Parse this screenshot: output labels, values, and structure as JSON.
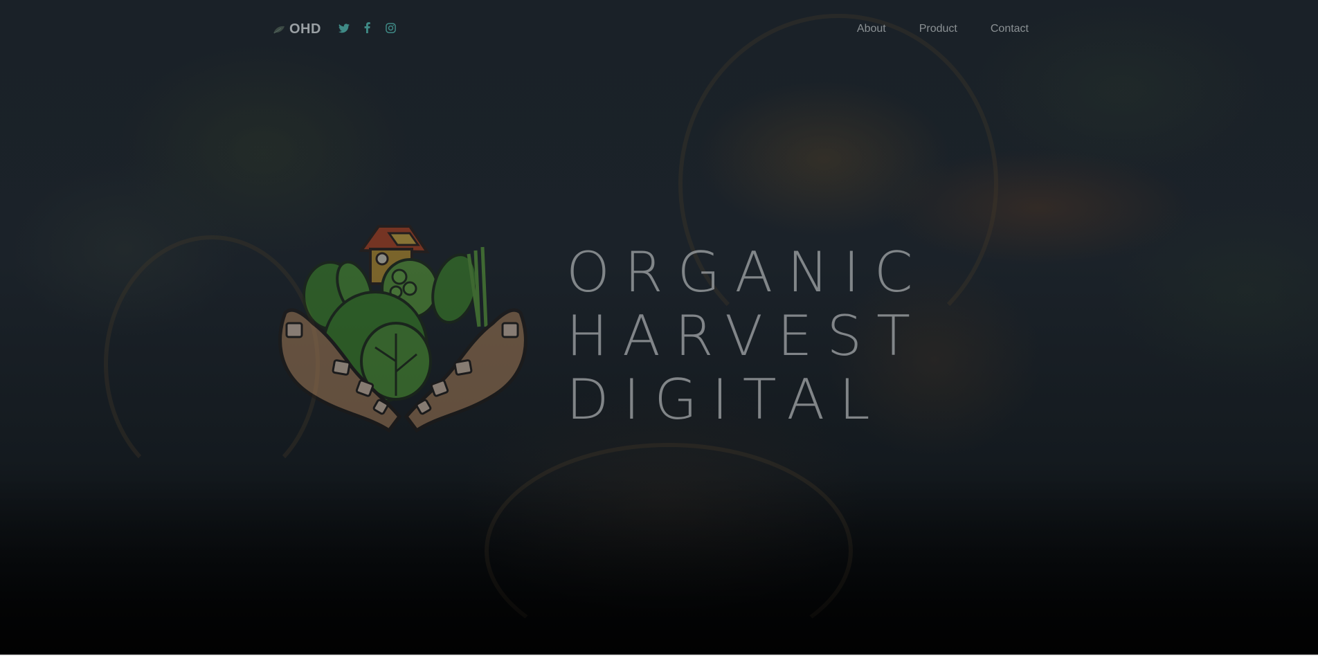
{
  "brand": {
    "name": "OHD",
    "leaf_icon": "leaf-icon"
  },
  "social": [
    {
      "icon": "twitter-icon"
    },
    {
      "icon": "facebook-icon"
    },
    {
      "icon": "instagram-icon"
    }
  ],
  "nav": {
    "items": [
      {
        "label": "About"
      },
      {
        "label": "Product"
      },
      {
        "label": "Contact"
      }
    ]
  },
  "hero": {
    "logo_icon": "harvest-hands-icon",
    "wordmark": {
      "line1": "ORGANIC",
      "line2": "HARVEST",
      "line3": "DIGITAL"
    }
  },
  "colors": {
    "background": "#1b2229",
    "nav_text": "#8b9194",
    "brand_text": "#9aa0a4",
    "social_icon": "#3f8a86",
    "wordmark": "#8d9194"
  }
}
